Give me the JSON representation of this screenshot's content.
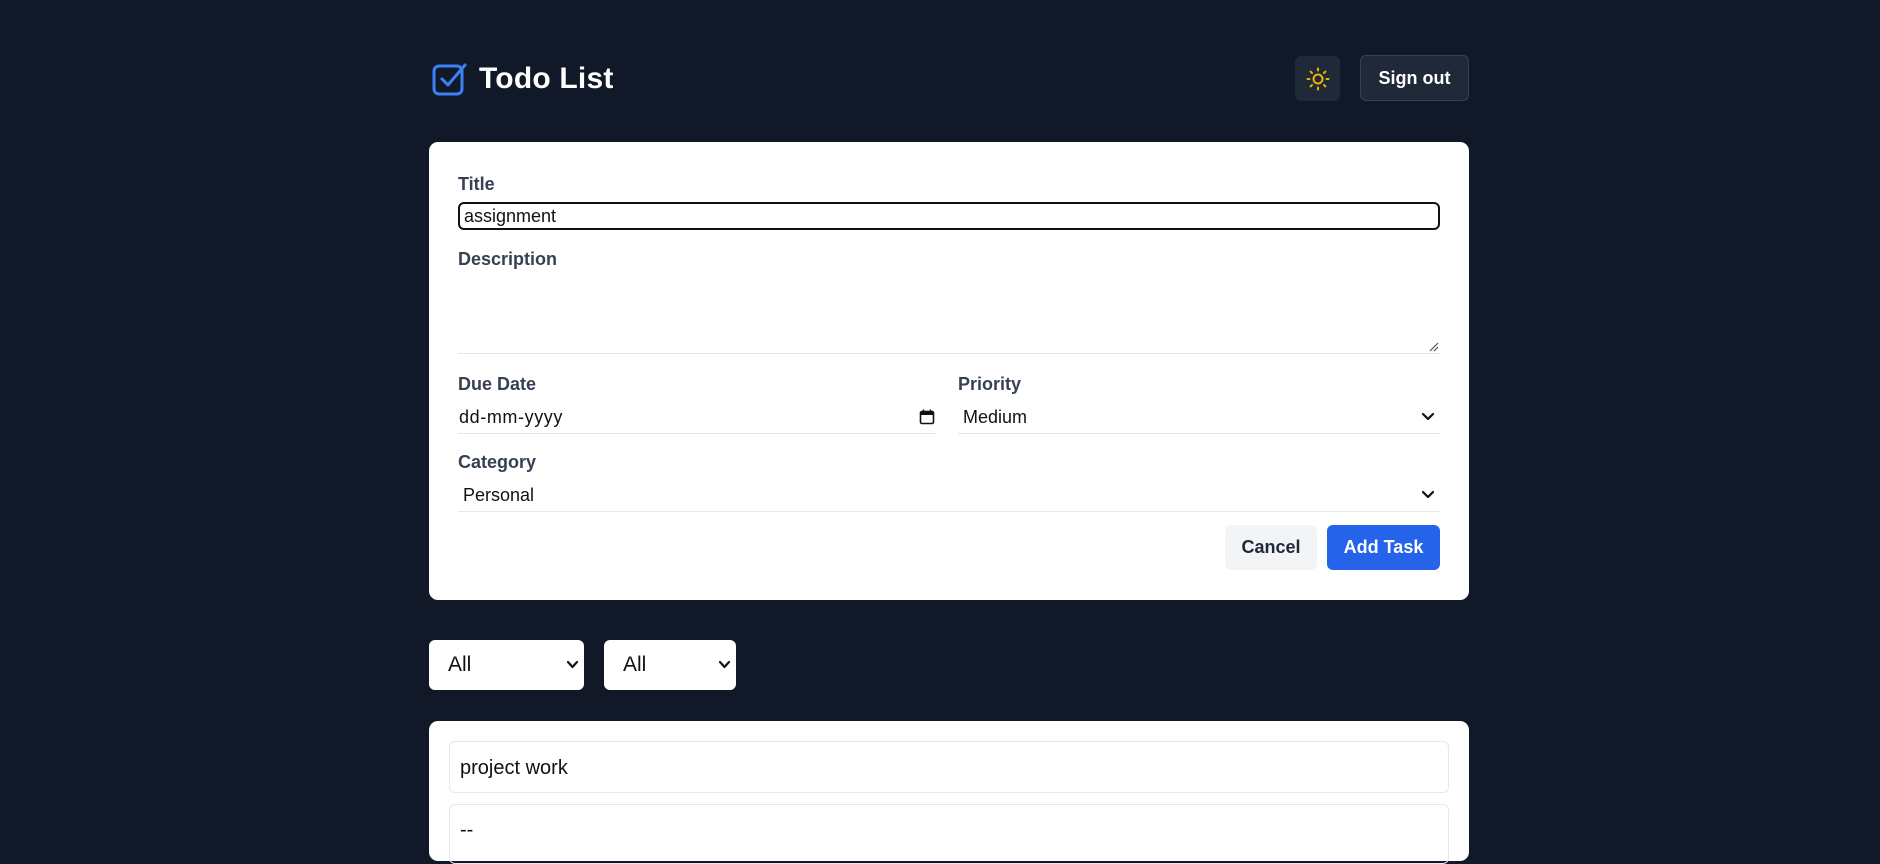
{
  "header": {
    "app_title": "Todo List",
    "sign_out_label": "Sign out"
  },
  "form": {
    "title_label": "Title",
    "title_value": "assignment",
    "description_label": "Description",
    "description_value": "",
    "due_date_label": "Due Date",
    "due_date_placeholder": "dd-mm-yyyy",
    "priority_label": "Priority",
    "priority_value": "Medium",
    "category_label": "Category",
    "category_value": "Personal",
    "cancel_label": "Cancel",
    "add_label": "Add Task"
  },
  "filters": {
    "status_value": "All",
    "priority_value": "All"
  },
  "todos": [
    {
      "title": "project work",
      "description": "--"
    }
  ],
  "colors": {
    "background": "#111827",
    "accent": "#2563eb",
    "logo": "#3b82f6",
    "sun": "#eab308"
  },
  "icons": {
    "logo": "checkbox-icon",
    "theme": "sun-icon",
    "calendar": "calendar-icon",
    "chevron": "chevron-down-icon"
  }
}
